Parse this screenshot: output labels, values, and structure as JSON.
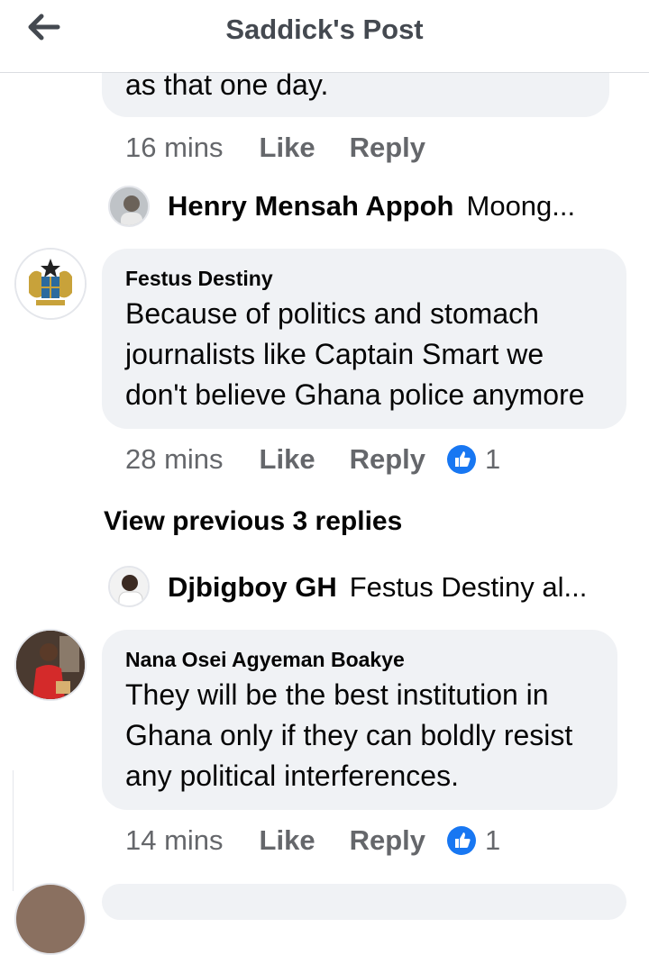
{
  "header": {
    "title": "Saddick's Post",
    "back_icon": "arrow-left-icon"
  },
  "comments": [
    {
      "text": "as that one day.",
      "meta": {
        "time": "16 mins",
        "like": "Like",
        "reply": "Reply"
      }
    },
    {
      "author": "Festus Destiny",
      "text_lines": [
        "Because of politics and stomach",
        "journalists like Captain Smart we",
        "don't believe Ghana police anymore"
      ],
      "meta": {
        "time": "28 mins",
        "like": "Like",
        "reply": "Reply",
        "reaction_count": "1"
      }
    },
    {
      "author": "Nana Osei Agyeman Boakye",
      "text_lines": [
        "They will be the best institution in",
        "Ghana only if they can boldly resist",
        "any political interferences."
      ],
      "meta": {
        "time": "14 mins",
        "like": "Like",
        "reply": "Reply",
        "reaction_count": "1"
      }
    }
  ],
  "reply_previews": [
    {
      "name": "Henry Mensah Appoh",
      "snippet": "Moong..."
    },
    {
      "name": "Djbigboy GH",
      "snippet": "Festus Destiny al..."
    }
  ],
  "view_previous": "View previous 3 replies",
  "colors": {
    "like_blue": "#1877f2",
    "bubble": "#f0f2f5",
    "muted": "#65676b"
  }
}
